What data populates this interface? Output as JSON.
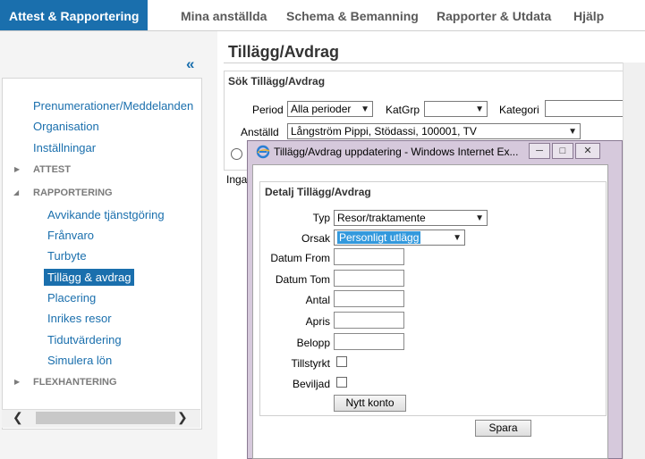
{
  "nav": {
    "tabs": [
      "Attest & Rapportering",
      "Mina anställda",
      "Schema & Bemanning",
      "Rapporter & Utdata",
      "Hjälp"
    ]
  },
  "sidebar": {
    "collapse_symbol": "«",
    "links": [
      "Prenumerationer/Meddelanden",
      "Organisation",
      "Inställningar"
    ],
    "attest_header": "ATTEST",
    "rapportering_header": "RAPPORTERING",
    "rapportering_items": [
      "Avvikande tjänstgöring",
      "Frånvaro",
      "Turbyte",
      "Tillägg & avdrag",
      "Placering",
      "Inrikes resor",
      "Tidutvärdering",
      "Simulera lön"
    ],
    "flex_header": "FLEXHANTERING"
  },
  "main": {
    "title": "Tillägg/Avdrag",
    "search": {
      "title": "Sök Tillägg/Avdrag",
      "period_label": "Period",
      "period_value": "Alla perioder",
      "katgrp_label": "KatGrp",
      "katgrp_value": "",
      "kategori_label": "Kategori",
      "anstalld_label": "Anställd",
      "anstalld_value": "Långström Pippi, Stödassi, 100001, TV"
    },
    "truncated_text": "Inga"
  },
  "popup": {
    "window_title": "Tillägg/Avdrag uppdatering - Windows Internet Ex...",
    "detail_title": "Detalj Tillägg/Avdrag",
    "typ_label": "Typ",
    "typ_value": "Resor/traktamente",
    "orsak_label": "Orsak",
    "orsak_value": "Personligt utlägg",
    "datum_from_label": "Datum From",
    "datum_tom_label": "Datum Tom",
    "antal_label": "Antal",
    "apris_label": "Apris",
    "belopp_label": "Belopp",
    "tillstyrkt_label": "Tillstyrkt",
    "beviljad_label": "Beviljad",
    "nytt_konto_label": "Nytt konto",
    "spara_label": "Spara"
  },
  "colors": {
    "accent": "#1a6fad",
    "popup_frame": "#d6c9dc"
  },
  "icons": [
    "ie-icon",
    "minimize-icon",
    "maximize-icon",
    "close-icon"
  ]
}
